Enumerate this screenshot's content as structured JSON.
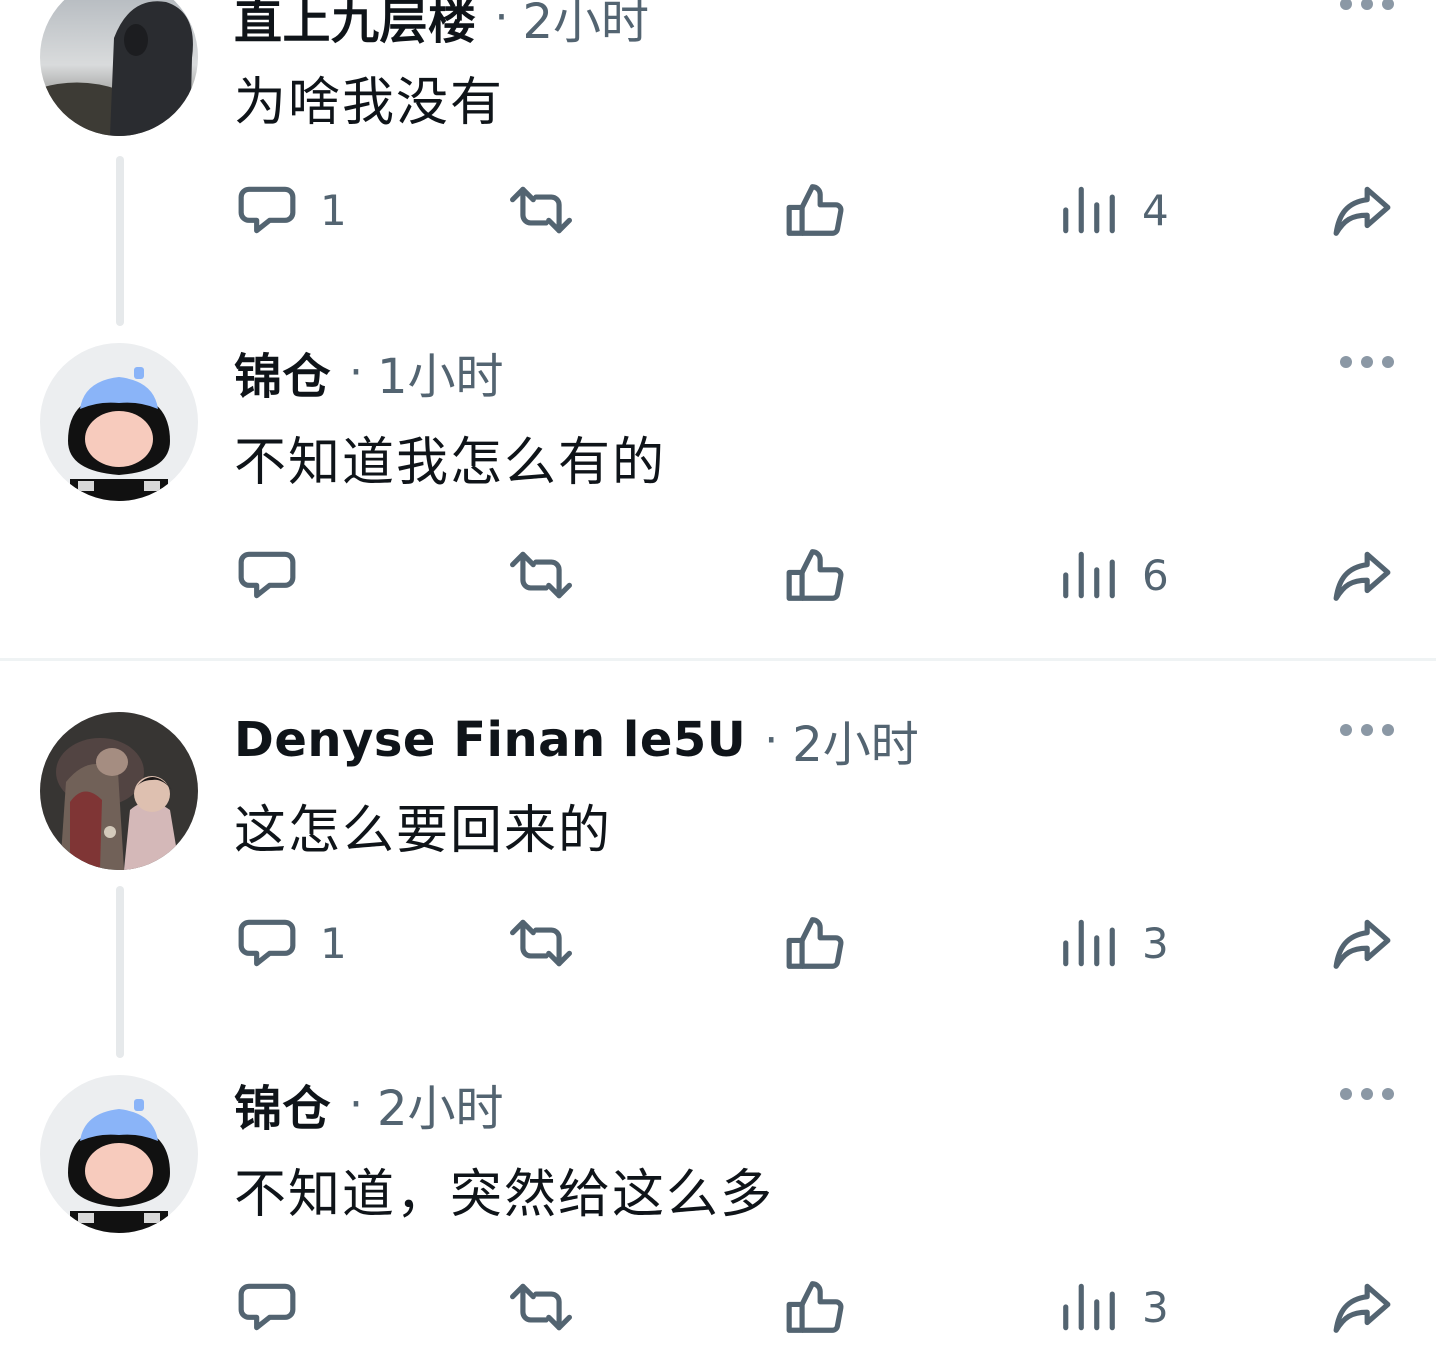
{
  "posts": [
    {
      "author": "直上九层楼",
      "separator": "·",
      "time": "2小时",
      "text": "为啥我没有",
      "avatar": "photo-hooded-person-avatar",
      "actions": {
        "reply_count": "1",
        "repost_count": "",
        "like_count": "",
        "view_count": "4"
      }
    },
    {
      "author": "锦仓",
      "separator": "·",
      "time": "1小时",
      "text": "不知道我怎么有的",
      "avatar": "cartoon-girl-blue-hat-avatar",
      "actions": {
        "reply_count": "",
        "repost_count": "",
        "like_count": "",
        "view_count": "6"
      }
    },
    {
      "author": "Denyse Finan le5U",
      "separator": "·",
      "time": "2小时",
      "text": "这怎么要回来的",
      "avatar": "photo-child-avatar",
      "actions": {
        "reply_count": "1",
        "repost_count": "",
        "like_count": "",
        "view_count": "3"
      }
    },
    {
      "author": "锦仓",
      "separator": "·",
      "time": "2小时",
      "text": "不知道，突然给这么多",
      "avatar": "cartoon-girl-blue-hat-avatar",
      "actions": {
        "reply_count": "",
        "repost_count": "",
        "like_count": "",
        "view_count": "3"
      }
    }
  ],
  "icons": {
    "reply": "reply-bubble-icon",
    "repost": "repost-icon",
    "like": "thumbs-up-icon",
    "views": "views-bar-chart-icon",
    "share": "share-arrow-icon",
    "more": "more-dots-icon"
  },
  "colors": {
    "text_primary": "#0f1419",
    "text_secondary": "#536471",
    "icon": "#536471",
    "thread_line": "#e6e9eb",
    "avatar_hat": "#8ab4f8"
  }
}
